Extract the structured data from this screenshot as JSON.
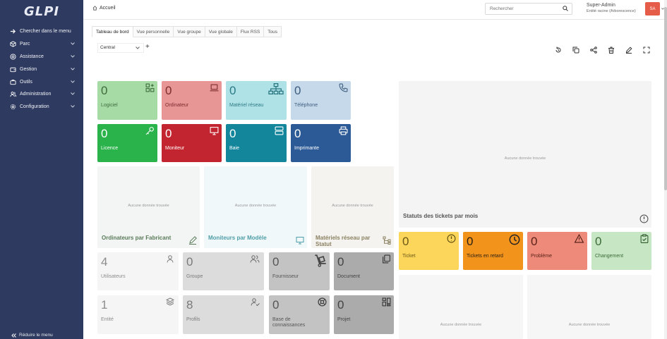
{
  "app": {
    "logo": "GLPI"
  },
  "sidebar": {
    "items": [
      {
        "label": "Chercher dans le menu",
        "icon": "arrow-right-icon"
      },
      {
        "label": "Parc",
        "icon": "box-icon"
      },
      {
        "label": "Assistance",
        "icon": "lifebuoy-icon"
      },
      {
        "label": "Gestion",
        "icon": "wallet-icon"
      },
      {
        "label": "Outils",
        "icon": "briefcase-icon"
      },
      {
        "label": "Administration",
        "icon": "users-icon"
      },
      {
        "label": "Configuration",
        "icon": "gear-icon"
      }
    ],
    "collapse_label": "Réduire le menu"
  },
  "header": {
    "breadcrumb": "Accueil",
    "search_placeholder": "Rechercher",
    "user_name": "Super-Admin",
    "user_entity": "Entité racine (Arborescence)",
    "avatar_initials": "SA"
  },
  "tabs": [
    "Tableau de bord",
    "Vue personnelle",
    "Vue groupe",
    "Vue globale",
    "Flux RSS",
    "Tous"
  ],
  "dashboard": {
    "selected": "Central",
    "plus": "+",
    "empty": "Aucune donnée trouvée",
    "cards": [
      {
        "value": "0",
        "label": "Logiciel",
        "icon": "apps-icon"
      },
      {
        "value": "0",
        "label": "Ordinateur",
        "icon": "laptop-icon"
      },
      {
        "value": "0",
        "label": "Matériel réseau",
        "icon": "network-icon"
      },
      {
        "value": "0",
        "label": "Téléphone",
        "icon": "phone-icon"
      },
      {
        "value": "0",
        "label": "Licence",
        "icon": "key-icon"
      },
      {
        "value": "0",
        "label": "Moniteur",
        "icon": "monitor-icon"
      },
      {
        "value": "0",
        "label": "Baie",
        "icon": "server-icon"
      },
      {
        "value": "0",
        "label": "Imprimante",
        "icon": "printer-icon"
      }
    ],
    "panels": [
      {
        "title": "Ordinateurs par Fabricant",
        "icon": "edit-icon"
      },
      {
        "title": "Moniteurs par Modèle",
        "icon": "monitor-icon"
      },
      {
        "title": "Matériels réseau par Statut",
        "icon": "hierarchy-icon"
      }
    ],
    "tickets_title": "Statuts des tickets par mois",
    "ticket_cards": [
      {
        "value": "0",
        "label": "Ticket",
        "icon": "info-icon"
      },
      {
        "value": "0",
        "label": "Tickets en retard",
        "icon": "clock-icon"
      },
      {
        "value": "0",
        "label": "Problème",
        "icon": "warning-icon"
      },
      {
        "value": "0",
        "label": "Changement",
        "icon": "clipboard-check-icon"
      }
    ],
    "admin_cards": [
      {
        "value": "4",
        "label": "Utilisateurs",
        "icon": "user-icon"
      },
      {
        "value": "0",
        "label": "Groupe",
        "icon": "group-icon"
      },
      {
        "value": "0",
        "label": "Fournisseur",
        "icon": "dolly-icon"
      },
      {
        "value": "0",
        "label": "Document",
        "icon": "documents-icon"
      },
      {
        "value": "1",
        "label": "Entité",
        "icon": "layers-icon"
      },
      {
        "value": "8",
        "label": "Profils",
        "icon": "user-check-icon"
      },
      {
        "value": "0",
        "label": "Base de connaissances",
        "icon": "lifebuoy-icon"
      },
      {
        "value": "0",
        "label": "Projet",
        "icon": "columns-icon"
      }
    ]
  },
  "colors": {
    "sidebar": "#2e3a5f",
    "logiciel": "#a7dba6",
    "ordinateur": "#e89595",
    "materiel": "#afe2e6",
    "telephone": "#c5d9ea",
    "licence": "#2bb34b",
    "moniteur": "#c2252f",
    "baie": "#14869c",
    "imprimante": "#2c5a96",
    "ticket": "#fbd65a",
    "retard": "#f2931c",
    "probleme": "#ee8a79",
    "changement": "#c7e6c4"
  }
}
